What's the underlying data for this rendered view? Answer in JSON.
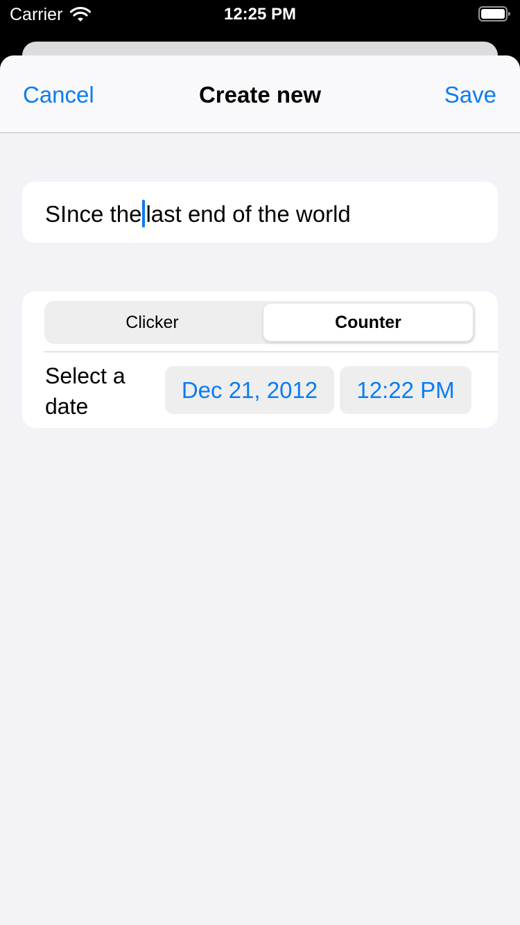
{
  "status_bar": {
    "carrier": "Carrier",
    "time": "12:25 PM",
    "icons": [
      "wifi-icon",
      "battery-icon"
    ]
  },
  "nav": {
    "cancel_label": "Cancel",
    "title": "Create new",
    "save_label": "Save"
  },
  "form": {
    "title_value_before_cursor": "SInce the",
    "title_value_after_cursor": "last end of the world",
    "segments": [
      "Clicker",
      "Counter"
    ],
    "selected_segment": "Counter",
    "date_label": "Select a date",
    "date_value": "Dec 21, 2012",
    "time_value": "12:22 PM"
  },
  "colors": {
    "accent": "#0a7cf2",
    "background": "#f2f2f7",
    "card": "#ffffff"
  }
}
